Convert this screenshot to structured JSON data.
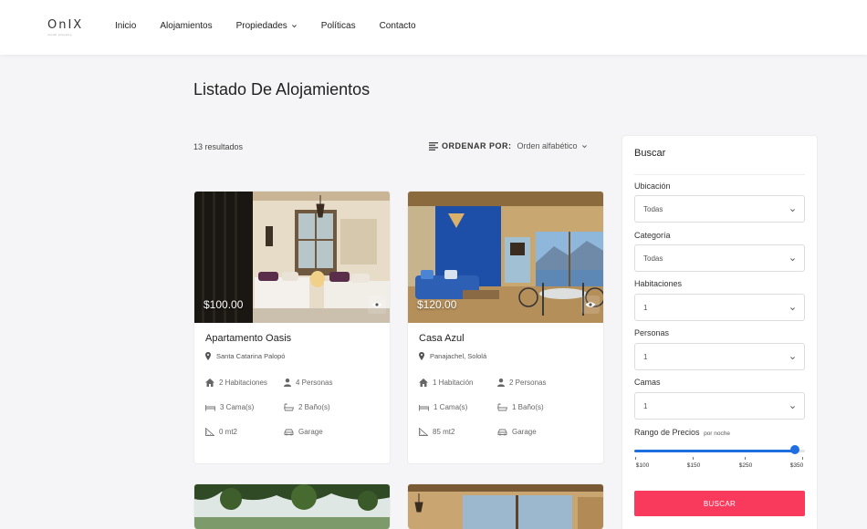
{
  "header": {
    "logo": "OnIX",
    "logo_sub": "rental property",
    "nav": [
      "Inicio",
      "Alojamientos",
      "Propiedades",
      "Políticas",
      "Contacto"
    ]
  },
  "page": {
    "title": "Listado De Alojamientos",
    "results": "13 resultados",
    "sort_label": "ORDENAR POR:",
    "sort_value": "Orden alfabético"
  },
  "cards": [
    {
      "price": "$100.00",
      "title": "Apartamento Oasis",
      "location": "Santa Catarina Palopó",
      "rooms": "2 Habitaciones",
      "people": "4 Personas",
      "beds": "3 Cama(s)",
      "baths": "2 Baño(s)",
      "area": "0 mt2",
      "garage": "Garage"
    },
    {
      "price": "$120.00",
      "title": "Casa Azul",
      "location": "Panajachel, Sololá",
      "rooms": "1 Habitación",
      "people": "2 Personas",
      "beds": "1 Cama(s)",
      "baths": "1 Baño(s)",
      "area": "85 mt2",
      "garage": "Garage"
    }
  ],
  "sidebar": {
    "title": "Buscar",
    "filters": [
      {
        "label": "Ubicación",
        "value": "Todas"
      },
      {
        "label": "Categoría",
        "value": "Todas"
      },
      {
        "label": "Habitaciones",
        "value": "1"
      },
      {
        "label": "Personas",
        "value": "1"
      },
      {
        "label": "Camas",
        "value": "1"
      }
    ],
    "range_label": "Rango de Precios",
    "range_sub": "por noche",
    "range_ticks": [
      "$100",
      "$150",
      "$250",
      "$350"
    ],
    "range_fill_fraction": 0.94,
    "button": "BUSCAR"
  },
  "colors": {
    "accent": "#fa3a5d",
    "slider": "#1f6fe0"
  }
}
